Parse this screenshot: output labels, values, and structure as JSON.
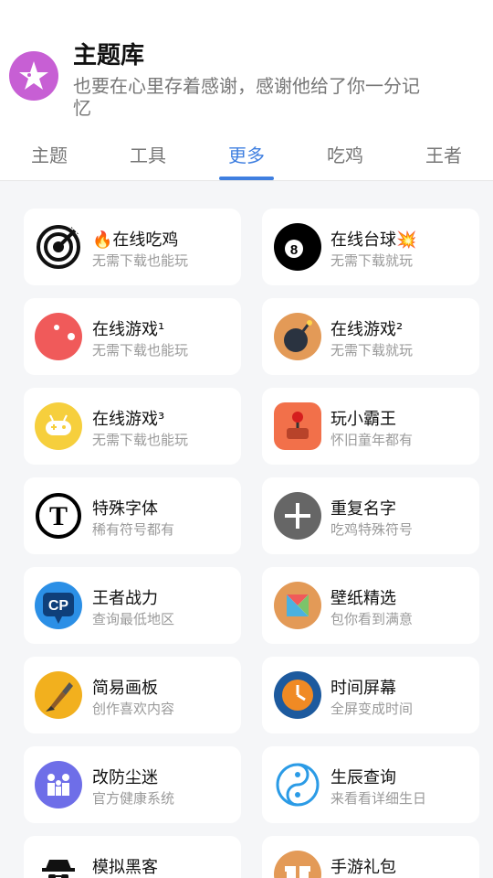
{
  "header": {
    "title": "主题库",
    "subtitle": "也要在心里存着感谢，感谢他给了你一分记忆",
    "logo_icon": "star-icon",
    "logo_color": "#c75fd4"
  },
  "tabs": [
    {
      "label": "主题",
      "active": false
    },
    {
      "label": "工具",
      "active": false
    },
    {
      "label": "更多",
      "active": true
    },
    {
      "label": "吃鸡",
      "active": false
    },
    {
      "label": "王者",
      "active": false
    }
  ],
  "accent_color": "#3f7fe0",
  "cards": [
    {
      "title": "🔥在线吃鸡",
      "sub": "无需下载也能玩",
      "icon": "target-icon",
      "color": "#ffffff"
    },
    {
      "title": "在线台球💥",
      "sub": "无需下载就玩",
      "icon": "billiard-8-ball-icon",
      "color": "#000000"
    },
    {
      "title": "在线游戏¹",
      "sub": "无需下载也能玩",
      "icon": "pacman-icon",
      "color": "#f05a5a"
    },
    {
      "title": "在线游戏²",
      "sub": "无需下载就玩",
      "icon": "bomb-icon",
      "color": "#e39a57"
    },
    {
      "title": "在线游戏³",
      "sub": "无需下载也能玩",
      "icon": "gamepad-icon",
      "color": "#f6cf3d"
    },
    {
      "title": "玩小霸王",
      "sub": "怀旧童年都有",
      "icon": "joystick-icon",
      "color": "#f2704a"
    },
    {
      "title": "特殊字体",
      "sub": "稀有符号都有",
      "icon": "font-t-icon",
      "color": "#ffffff"
    },
    {
      "title": "重复名字",
      "sub": "吃鸡特殊符号",
      "icon": "plus-icon",
      "color": "#666666"
    },
    {
      "title": "王者战力",
      "sub": "查询最低地区",
      "icon": "cp-badge-icon",
      "color": "#2b8fe6"
    },
    {
      "title": "壁纸精选",
      "sub": "包你看到满意",
      "icon": "wallpaper-icon",
      "color": "#e39a57"
    },
    {
      "title": "简易画板",
      "sub": "创作喜欢内容",
      "icon": "paintbrush-icon",
      "color": "#f2b01e"
    },
    {
      "title": "时间屏幕",
      "sub": "全屏变成时间",
      "icon": "clock-icon",
      "color": "#1d5a9e"
    },
    {
      "title": "改防尘迷",
      "sub": "官方健康系统",
      "icon": "family-icon",
      "color": "#6e6ee8"
    },
    {
      "title": "生辰查询",
      "sub": "来看看详细生日",
      "icon": "yin-yang-icon",
      "color": "#2b9be6"
    },
    {
      "title": "模拟黑客",
      "sub": "",
      "icon": "hacker-icon",
      "color": "#ffffff"
    },
    {
      "title": "手游礼包",
      "sub": "",
      "icon": "gift-icon",
      "color": "#e39a57"
    }
  ]
}
